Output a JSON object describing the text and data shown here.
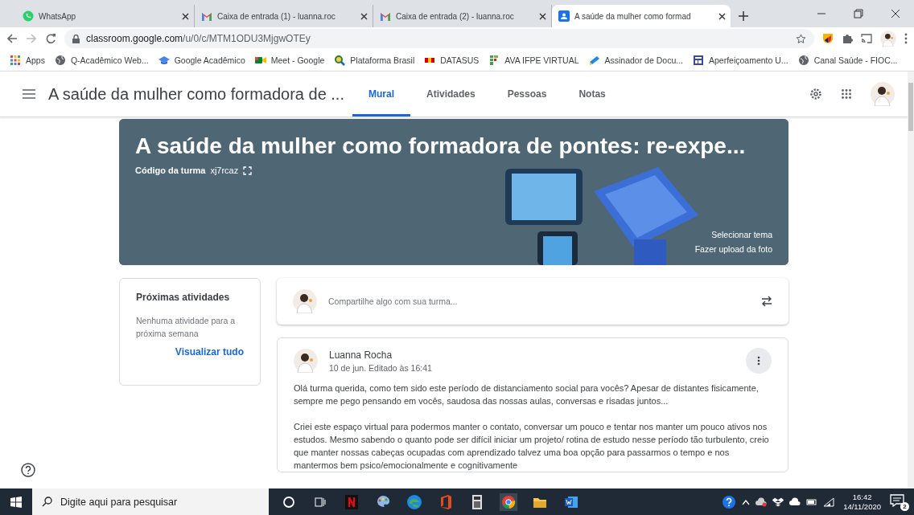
{
  "browser_tabs": [
    {
      "title": "WhatsApp",
      "kind": "chat",
      "selected": false
    },
    {
      "title": "Caixa de entrada (1) - luanna.roc",
      "kind": "mail",
      "selected": false
    },
    {
      "title": "Caixa de entrada (2) - luanna.roc",
      "kind": "mail",
      "selected": false
    },
    {
      "title": "A saúde da mulher como formad",
      "kind": "classroom",
      "selected": true
    }
  ],
  "address": {
    "host": "classroom.google.com",
    "path": "/u/0/c/MTM1ODU3MjgwOTEy"
  },
  "bookmarks": [
    {
      "label": "Apps",
      "kind": "apps"
    },
    {
      "label": "Q-Acadêmico Web...",
      "kind": "globe"
    },
    {
      "label": "Google Acadêmico",
      "kind": "cap"
    },
    {
      "label": "Meet - Google",
      "kind": "video"
    },
    {
      "label": "Plataforma Brasil",
      "kind": "magnifier"
    },
    {
      "label": "DATASUS",
      "kind": "flag"
    },
    {
      "label": "AVA IFPE VIRTUAL",
      "kind": "blocks"
    },
    {
      "label": "Assinador de Docu...",
      "kind": "pen"
    },
    {
      "label": "Aperfeiçoamento U...",
      "kind": "form"
    },
    {
      "label": "Canal Saúde - FIOC...",
      "kind": "globe"
    }
  ],
  "class_header": {
    "title": "A saúde da mulher como formadora de ...",
    "tabs": [
      {
        "label": "Mural",
        "selected": true
      },
      {
        "label": "Atividades",
        "selected": false
      },
      {
        "label": "Pessoas",
        "selected": false
      },
      {
        "label": "Notas",
        "selected": false
      }
    ]
  },
  "banner": {
    "title": "A saúde da mulher como formadora de pontes: re-expe...",
    "code_label": "Código da turma",
    "code": "xj7rcaz",
    "links": [
      "Selecionar tema",
      "Fazer upload da foto"
    ]
  },
  "upcoming": {
    "title": "Próximas atividades",
    "empty_text": "Nenhuma atividade para a próxima semana",
    "link": "Visualizar tudo"
  },
  "share": {
    "placeholder": "Compartilhe algo com sua turma..."
  },
  "post": {
    "author": "Luanna Rocha",
    "meta": "10 de jun. Editado às 16:41",
    "paragraphs": [
      "Olá turma querida, como tem sido este período de distanciamento social para vocês? Apesar de distantes fisicamente, sempre me pego pensando em vocês, saudosa das nossas aulas, conversas e risadas juntos...",
      "Criei este espaço virtual para podermos manter o contato, conversar um pouco e tentar nos manter um pouco ativos nos estudos. Mesmo sabendo o quanto pode ser difícil iniciar um projeto/ rotina de estudo nesse período tão turbulento, creio que manter nossas cabeças ocupadas com aprendizado talvez uma boa opção para passarmos o tempo e nos mantermos bem psico/emocionalmente e cognitivamente"
    ]
  },
  "taskbar": {
    "search_placeholder": "Digite aqui para pesquisar",
    "time": "16:42",
    "date": "14/11/2020",
    "notifications": "2"
  }
}
